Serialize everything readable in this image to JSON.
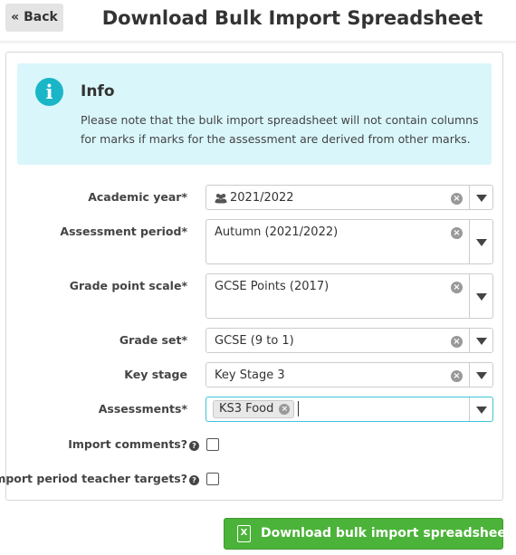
{
  "header": {
    "back_label": "« Back",
    "title": "Download Bulk Import Spreadsheet"
  },
  "info": {
    "icon": "info-circle-icon",
    "title": "Info",
    "text": "Please note that the bulk import spreadsheet will not contain columns for marks if marks for the assessment are derived from other marks."
  },
  "form": {
    "academic_year": {
      "label": "Academic year*",
      "value": "2021/2022",
      "icon": "people-icon"
    },
    "assessment_period": {
      "label": "Assessment period*",
      "value": "Autumn (2021/2022)"
    },
    "grade_point_scale": {
      "label": "Grade point scale*",
      "value": "GCSE Points (2017)"
    },
    "grade_set": {
      "label": "Grade set*",
      "value": "GCSE (9 to 1)"
    },
    "key_stage": {
      "label": "Key stage",
      "value": "Key Stage 3"
    },
    "assessments": {
      "label": "Assessments*",
      "tags": [
        "KS3 Food"
      ]
    },
    "import_comments": {
      "label": "Import comments?",
      "checked": false
    },
    "import_targets": {
      "label": "Import period teacher targets?",
      "checked": false
    }
  },
  "actions": {
    "download_label": "Download bulk import spreadsheet"
  },
  "colors": {
    "info_bg": "#d9f6fb",
    "info_icon": "#1ab6c8",
    "primary_green": "#4bb339",
    "focus_border": "#3ec4d6"
  }
}
